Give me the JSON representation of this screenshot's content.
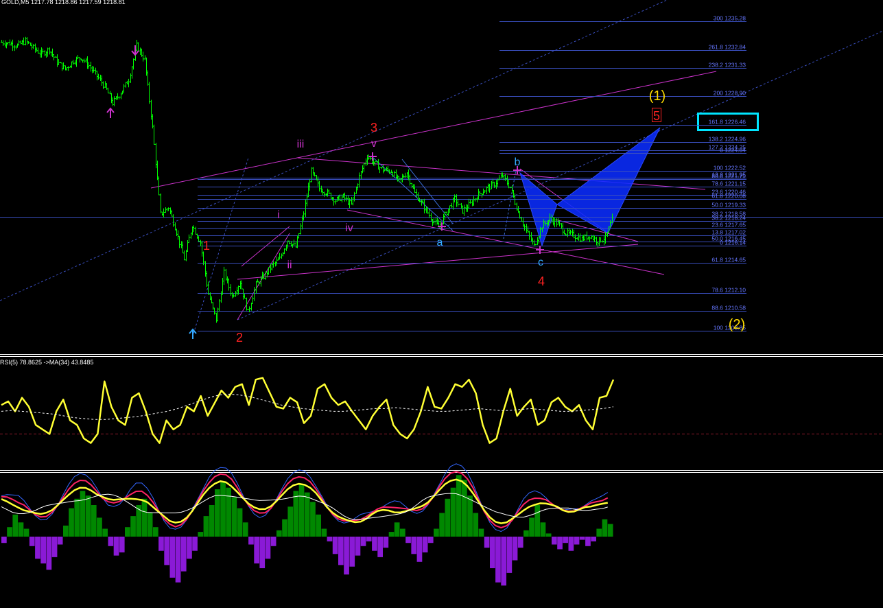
{
  "symbol_header": "GOLD,M5  1217.78 1218.86 1217.59 1218.81",
  "colors": {
    "background": "#000000",
    "candles": "#00ff00",
    "fib_lines": "#3a4fc0",
    "fib_text": "#6677ff",
    "channel": "#cc33cc",
    "dotted_channel": "#3a4fc0",
    "pattern_fill": "#0a2cff",
    "rsi": "#ffff33",
    "rsi_ma": "#ffffff",
    "hist_positive": "#008800",
    "hist_negative": "#8a1ad6",
    "wave_red": "#ff2222",
    "wave_magenta": "#cc33cc",
    "wave_cyan": "#33aaff",
    "wave_yellow": "#ffdd00",
    "highlight_box": "#00e5ff"
  },
  "fib_right": [
    {
      "level": "300",
      "price": "1235.28"
    },
    {
      "level": "261.8",
      "price": "1232.84"
    },
    {
      "level": "238.2",
      "price": "1231.33"
    },
    {
      "level": "200",
      "price": "1228.90"
    },
    {
      "level": "161.8",
      "price": "1226.46"
    },
    {
      "level": "138.2",
      "price": "1224.96"
    },
    {
      "level": "127.2",
      "price": "1224.25"
    },
    {
      "level": "0",
      "price": "1224.04"
    },
    {
      "level": "100",
      "price": "1222.52"
    },
    {
      "level": "13.8",
      "price": "1221.95"
    },
    {
      "level": "88.6",
      "price": "1221.79"
    },
    {
      "level": "78.6",
      "price": "1221.15"
    },
    {
      "level": "23.6",
      "price": "1220.46"
    },
    {
      "level": "61.8",
      "price": "1220.08"
    },
    {
      "level": "50.0",
      "price": "1219.33"
    },
    {
      "level": "38.2",
      "price": "1218.58"
    },
    {
      "level": "38.2",
      "price": "1218.24"
    },
    {
      "level": "23.6",
      "price": "1217.65"
    },
    {
      "level": "13.8",
      "price": "1217.02"
    },
    {
      "level": "50.0",
      "price": "1216.45"
    },
    {
      "level": "0",
      "price": "1216.14"
    },
    {
      "level": "61.8",
      "price": "1214.65"
    },
    {
      "level": "78.6",
      "price": "1212.10"
    },
    {
      "level": "88.6",
      "price": "1210.58"
    },
    {
      "level": "100",
      "price": "1208.85"
    }
  ],
  "wave_labels": [
    {
      "text": "1",
      "color": "red"
    },
    {
      "text": "2",
      "color": "red"
    },
    {
      "text": "3",
      "color": "red"
    },
    {
      "text": "4",
      "color": "red"
    },
    {
      "text": "5",
      "color": "red"
    },
    {
      "text": "i",
      "color": "magenta"
    },
    {
      "text": "ii",
      "color": "magenta"
    },
    {
      "text": "iii",
      "color": "magenta"
    },
    {
      "text": "iv",
      "color": "magenta"
    },
    {
      "text": "v",
      "color": "magenta"
    },
    {
      "text": "a",
      "color": "cyan"
    },
    {
      "text": "b",
      "color": "cyan"
    },
    {
      "text": "c",
      "color": "cyan"
    },
    {
      "text": "(1)",
      "color": "yellow"
    },
    {
      "text": "(2)",
      "color": "yellow"
    }
  ],
  "rsi_header": "RSI(5) 78.8625  ->MA(34) 43.8485",
  "chart_data": {
    "type": "line",
    "title": "GOLD,M5",
    "ohlc_last": {
      "open": 1217.78,
      "high": 1218.86,
      "low": 1217.59,
      "close": 1218.81
    },
    "ylim": [
      1207.8,
      1236.4
    ],
    "price_path": [
      1233.5,
      1233.4,
      1233.2,
      1233.6,
      1233.0,
      1232.5,
      1232.9,
      1231.8,
      1231.2,
      1231.9,
      1232.2,
      1231.5,
      1230.6,
      1229.7,
      1228.3,
      1229.2,
      1230.3,
      1233.2,
      1232.0,
      1226.2,
      1218.8,
      1219.4,
      1217.3,
      1215.0,
      1217.9,
      1216.4,
      1212.0,
      1209.8,
      1213.8,
      1211.8,
      1213.0,
      1210.4,
      1212.8,
      1213.5,
      1214.4,
      1215.0,
      1216.6,
      1216.0,
      1218.9,
      1222.5,
      1221.0,
      1220.6,
      1220.0,
      1220.3,
      1219.6,
      1222.0,
      1223.8,
      1223.1,
      1222.6,
      1222.5,
      1221.6,
      1222.4,
      1220.6,
      1219.6,
      1218.5,
      1217.7,
      1219.0,
      1220.1,
      1219.1,
      1219.7,
      1220.5,
      1221.0,
      1221.4,
      1222.1,
      1221.1,
      1219.0,
      1217.4,
      1216.1,
      1217.8,
      1218.4,
      1218.0,
      1217.2,
      1217.0,
      1216.7,
      1217.0,
      1216.5,
      1216.8,
      1218.7
    ],
    "rsi": {
      "name": "RSI(5)",
      "last": 78.8625,
      "ma_period": 34,
      "ma_last": 43.8485,
      "values": [
        62,
        66,
        55,
        70,
        60,
        40,
        35,
        30,
        55,
        68,
        45,
        40,
        25,
        20,
        30,
        88,
        60,
        45,
        40,
        70,
        75,
        55,
        30,
        20,
        45,
        35,
        40,
        60,
        55,
        72,
        50,
        64,
        78,
        70,
        82,
        85,
        62,
        90,
        92,
        76,
        60,
        58,
        70,
        65,
        42,
        50,
        80,
        85,
        70,
        62,
        66,
        55,
        45,
        35,
        50,
        60,
        68,
        40,
        30,
        25,
        35,
        55,
        82,
        60,
        58,
        70,
        85,
        82,
        90,
        75,
        40,
        20,
        25,
        55,
        80,
        50,
        60,
        68,
        40,
        45,
        65,
        70,
        60,
        55,
        62,
        45,
        35,
        70,
        72,
        90
      ],
      "ma": [
        55,
        56,
        55,
        54,
        53,
        52,
        50,
        48,
        47,
        46,
        46,
        47,
        48,
        49,
        51,
        53,
        55,
        58,
        62,
        66,
        70,
        73,
        74,
        73,
        71,
        68,
        65,
        62,
        60,
        58,
        57,
        56,
        55,
        55,
        56,
        57,
        58,
        58,
        59,
        58,
        57,
        56,
        55,
        55,
        56,
        57,
        58,
        57,
        56,
        56,
        57,
        58,
        57,
        56,
        55,
        55,
        56,
        57,
        58,
        60
      ]
    },
    "histogram": {
      "values": [
        -8,
        12,
        28,
        18,
        10,
        -12,
        -28,
        -34,
        -42,
        -26,
        -10,
        14,
        36,
        48,
        58,
        52,
        40,
        24,
        10,
        -12,
        -24,
        -20,
        12,
        26,
        40,
        48,
        30,
        12,
        -18,
        -36,
        -52,
        -58,
        -44,
        -28,
        -18,
        6,
        26,
        40,
        60,
        70,
        62,
        50,
        36,
        18,
        -10,
        -34,
        -40,
        -28,
        -12,
        8,
        22,
        38,
        58,
        66,
        56,
        44,
        28,
        10,
        -6,
        -22,
        -36,
        -48,
        -38,
        -24,
        -12,
        -6,
        -18,
        -26,
        -14,
        6,
        18,
        10,
        -8,
        -22,
        -32,
        -20,
        -8,
        10,
        30,
        48,
        62,
        78,
        72,
        52,
        30,
        10,
        -14,
        -40,
        -58,
        -62,
        -46,
        -30,
        -14,
        8,
        24,
        40,
        18,
        4,
        -10,
        -16,
        -8,
        -18,
        -10,
        -4,
        -12,
        -6,
        10,
        22,
        16
      ]
    }
  }
}
